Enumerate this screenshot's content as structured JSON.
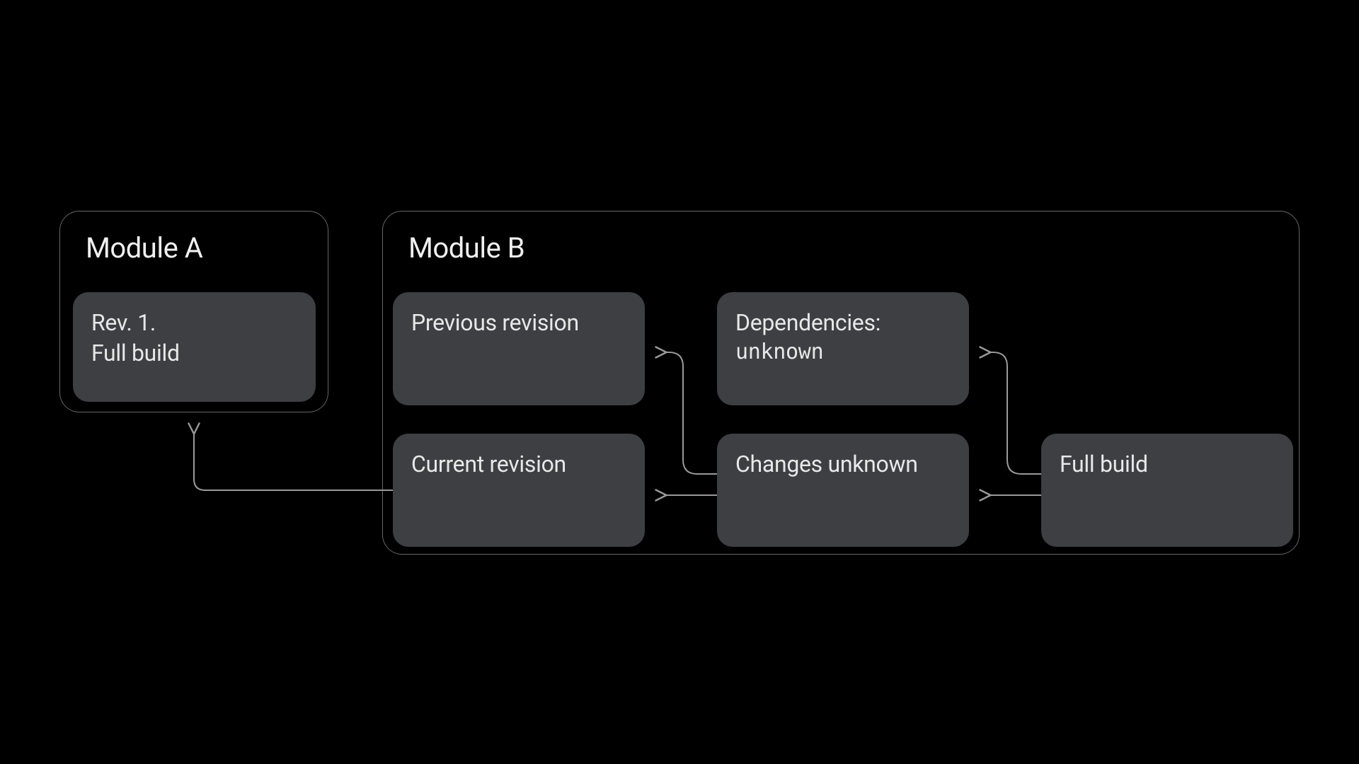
{
  "moduleA": {
    "title": "Module A",
    "card": {
      "line1": "Rev. 1.",
      "line2": "Full build"
    }
  },
  "moduleB": {
    "title": "Module B",
    "cards": {
      "prevRevision": "Previous revision",
      "currRevision": "Current revision",
      "depsLine1": "Dependencies:",
      "depsLine2": "unknown",
      "changes": "Changes unknown",
      "fullBuild": "Full build"
    }
  }
}
